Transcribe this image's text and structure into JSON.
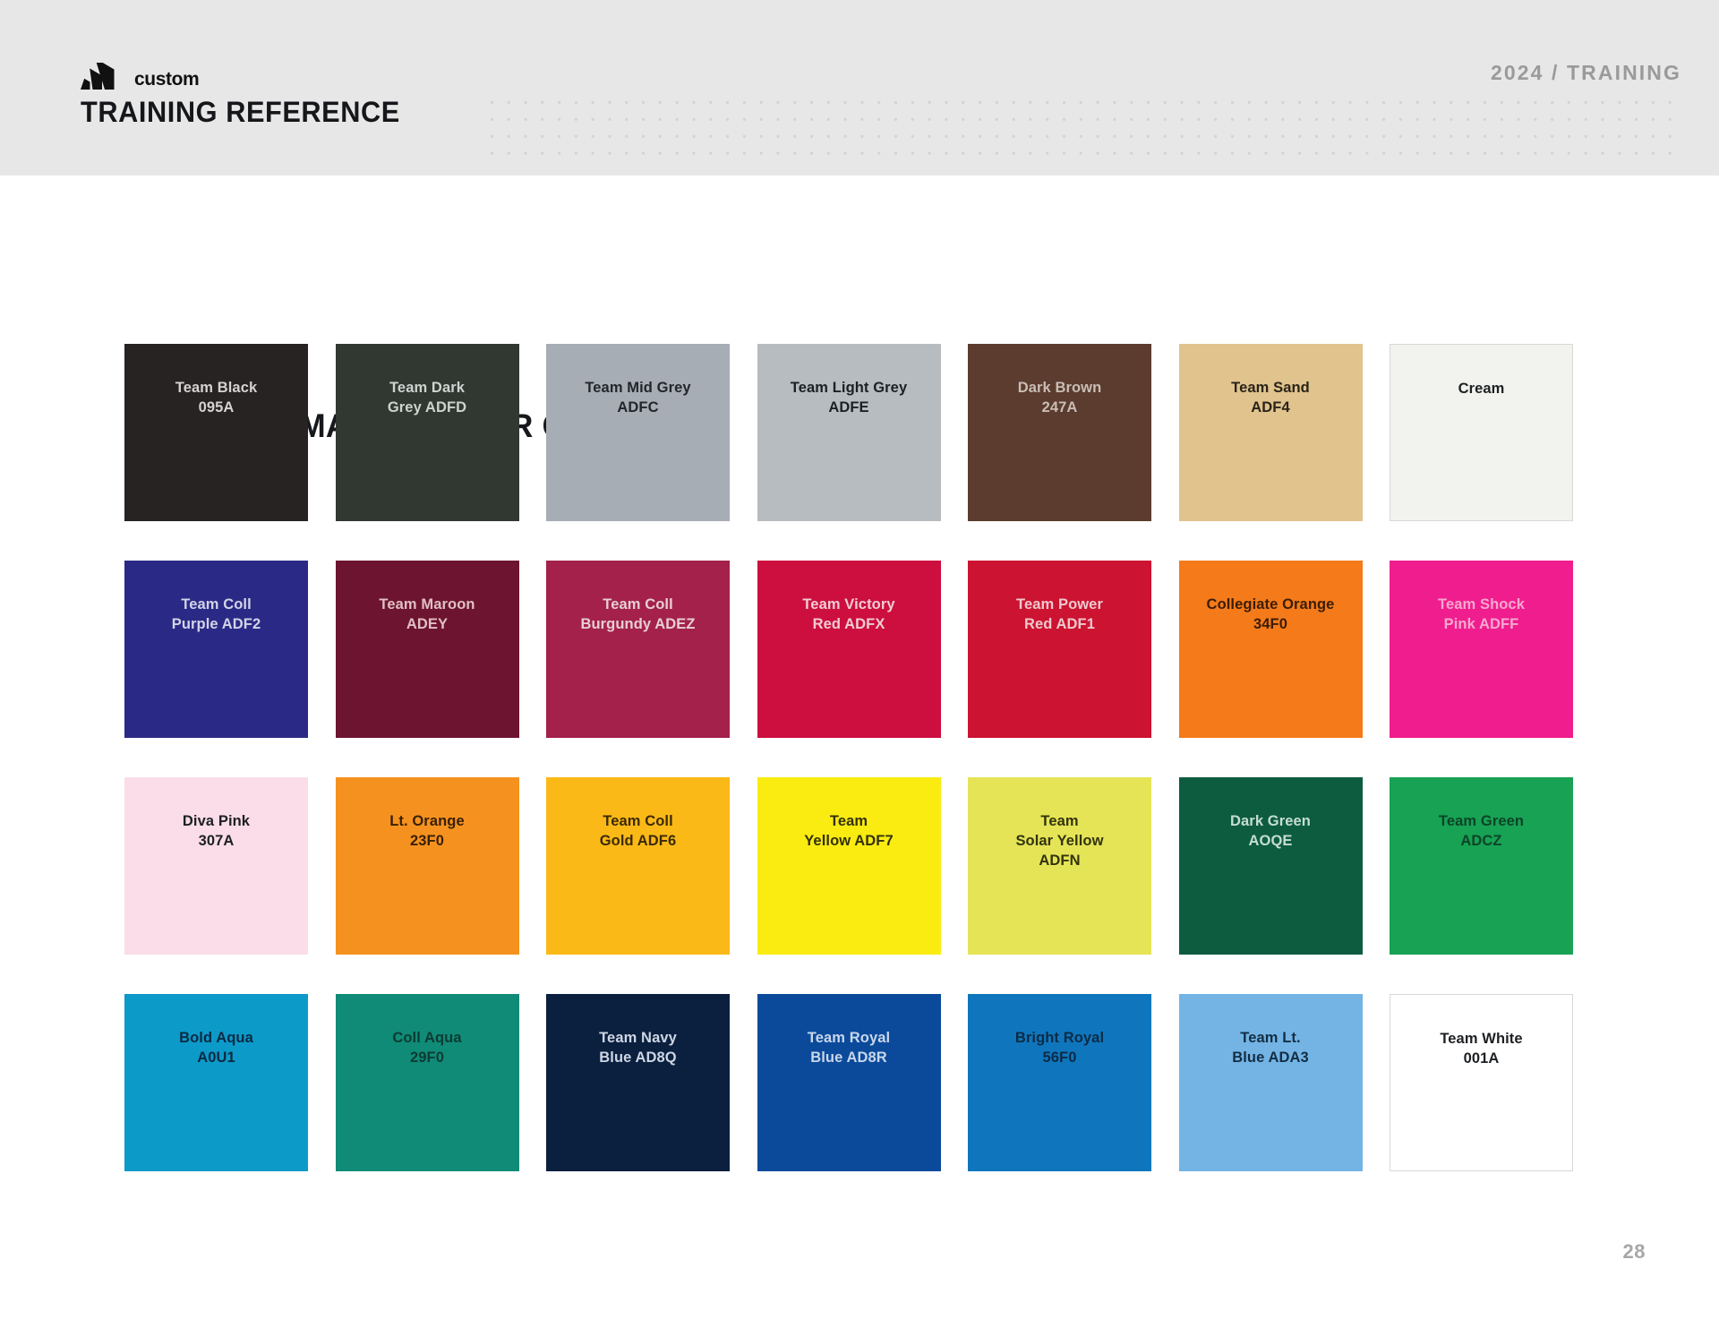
{
  "header": {
    "logo_brand": "adidas-logo",
    "logo_word": "custom",
    "title": "TRAINING REFERENCE",
    "eyebrow": "2024 / TRAINING",
    "bg_color": "#e7e7e7",
    "dot_color": "#d2d2d2"
  },
  "main": {
    "page_title": "SUBLIMATED COLOR OPTIONS",
    "page_number": "28"
  },
  "swatches": [
    {
      "name": "Team Black",
      "code": "095A",
      "label": "Team Black\n095A",
      "bg": "#262322",
      "text": "#d5d3d1",
      "outlined": false
    },
    {
      "name": "Team Dark Grey",
      "code": "ADFD",
      "label": "Team Dark\nGrey ADFD",
      "bg": "#313832",
      "text": "#cfd3d0",
      "outlined": false
    },
    {
      "name": "Team Mid Grey",
      "code": "ADFC",
      "label": "Team Mid Grey\nADFC",
      "bg": "#a7adb5",
      "text": "#22262b",
      "outlined": false
    },
    {
      "name": "Team Light Grey",
      "code": "ADFE",
      "label": "Team Light Grey\nADFE",
      "bg": "#b7bcc0",
      "text": "#1d2023",
      "outlined": false
    },
    {
      "name": "Dark Brown",
      "code": "247A",
      "label": "Dark Brown\n247A",
      "bg": "#5b3c2e",
      "text": "#c9bdb6",
      "outlined": false
    },
    {
      "name": "Team Sand",
      "code": "ADF4",
      "label": "Team Sand\nADF4",
      "bg": "#e0c38d",
      "text": "#2a2318",
      "outlined": false
    },
    {
      "name": "Cream",
      "code": "",
      "label": "Cream",
      "bg": "#f2f3ef",
      "text": "#1d1f22",
      "outlined": true
    },
    {
      "name": "Team Coll Purple",
      "code": "ADF2",
      "label": "Team Coll\nPurple ADF2",
      "bg": "#2a2a86",
      "text": "#d3d4e8",
      "outlined": false
    },
    {
      "name": "Team Maroon",
      "code": "ADEY",
      "label": "Team Maroon\nADEY",
      "bg": "#6d1430",
      "text": "#e0bfc6",
      "outlined": false
    },
    {
      "name": "Team Coll Burgundy",
      "code": "ADEZ",
      "label": "Team Coll\nBurgundy ADEZ",
      "bg": "#a3214b",
      "text": "#e8ced6",
      "outlined": false
    },
    {
      "name": "Team Victory Red",
      "code": "ADFX",
      "label": "Team Victory\nRed ADFX",
      "bg": "#cc0f3e",
      "text": "#f2ccd4",
      "outlined": false
    },
    {
      "name": "Team Power Red",
      "code": "ADF1",
      "label": "Team Power\nRed ADF1",
      "bg": "#cc1331",
      "text": "#efc9cd",
      "outlined": false
    },
    {
      "name": "Collegiate Orange",
      "code": "34F0",
      "label": "Collegiate Orange\n34F0",
      "bg": "#f47a1a",
      "text": "#3b1d05",
      "outlined": false
    },
    {
      "name": "Team Shock Pink",
      "code": "ADFF",
      "label": "Team Shock\nPink ADFF",
      "bg": "#f01d8e",
      "text": "#f7a8cf",
      "outlined": false
    },
    {
      "name": "Diva Pink",
      "code": "307A",
      "label": "Diva Pink\n307A",
      "bg": "#fadde8",
      "text": "#1d2023",
      "outlined": false
    },
    {
      "name": "Lt. Orange",
      "code": "23F0",
      "label": "Lt. Orange\n23F0",
      "bg": "#f5921f",
      "text": "#3a2007",
      "outlined": false
    },
    {
      "name": "Team Coll Gold",
      "code": "ADF6",
      "label": "Team Coll\nGold ADF6",
      "bg": "#fbb917",
      "text": "#3b2a05",
      "outlined": false
    },
    {
      "name": "Team Yellow",
      "code": "ADF7",
      "label": "Team\nYellow ADF7",
      "bg": "#faec10",
      "text": "#33300b",
      "outlined": false
    },
    {
      "name": "Team Solar Yellow",
      "code": "ADFN",
      "label": "Team\nSolar Yellow\nADFN",
      "bg": "#e5e456",
      "text": "#32330f",
      "outlined": false
    },
    {
      "name": "Dark Green",
      "code": "AOQE",
      "label": "Dark Green\nAOQE",
      "bg": "#0d5c40",
      "text": "#c5ded2",
      "outlined": false
    },
    {
      "name": "Team Green",
      "code": "ADCZ",
      "label": "Team Green\nADCZ",
      "bg": "#17a254",
      "text": "#0d4427",
      "outlined": false
    },
    {
      "name": "Bold Aqua",
      "code": "A0U1",
      "label": "Bold Aqua\nA0U1",
      "bg": "#0c9ac9",
      "text": "#0b2a43",
      "outlined": false
    },
    {
      "name": "Coll Aqua",
      "code": "29F0",
      "label": "Coll Aqua\n29F0",
      "bg": "#108b77",
      "text": "#0c3b33",
      "outlined": false
    },
    {
      "name": "Team Navy Blue",
      "code": "AD8Q",
      "label": "Team Navy\nBlue AD8Q",
      "bg": "#0b1f3f",
      "text": "#cdd6e3",
      "outlined": false
    },
    {
      "name": "Team Royal Blue",
      "code": "AD8R",
      "label": "Team Royal\nBlue AD8R",
      "bg": "#0b4a9b",
      "text": "#c9d7ea",
      "outlined": false
    },
    {
      "name": "Bright Royal",
      "code": "56F0",
      "label": "Bright Royal\n56F0",
      "bg": "#0f76bd",
      "text": "#0d2b45",
      "outlined": false
    },
    {
      "name": "Team Lt. Blue",
      "code": "ADA3",
      "label": "Team Lt.\nBlue ADA3",
      "bg": "#73b4e5",
      "text": "#142d42",
      "outlined": false
    },
    {
      "name": "Team White",
      "code": "001A",
      "label": "Team White\n001A",
      "bg": "#ffffff",
      "text": "#1d2023",
      "outlined": true
    }
  ]
}
